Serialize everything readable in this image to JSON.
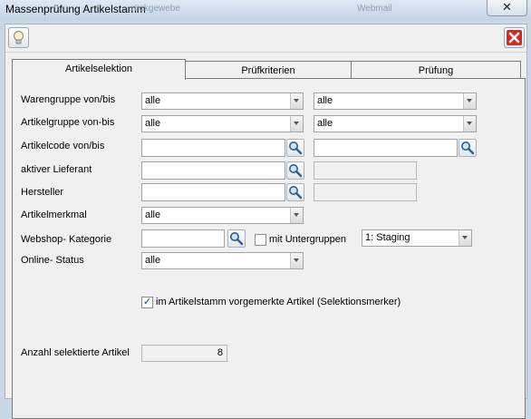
{
  "window": {
    "title": "Massenprüfung Artikelstamm",
    "background_ghost_1": "…rückgewebe",
    "background_ghost_2": "Webmail",
    "close_glyph": "✕"
  },
  "toolbar": {
    "help_icon": "lightbulb-icon",
    "close_icon": "red-x-icon"
  },
  "tabs": [
    {
      "label": "Artikelselektion",
      "active": true
    },
    {
      "label": "Prüfkriterien",
      "active": false
    },
    {
      "label": "Prüfung",
      "active": false
    }
  ],
  "form": {
    "warengruppe": {
      "label": "Warengruppe von/bis",
      "from": "alle",
      "to": "alle"
    },
    "artikelgruppe": {
      "label": "Artikelgruppe von-bis",
      "from": "alle",
      "to": "alle"
    },
    "artikelcode": {
      "label": "Artikelcode von/bis",
      "from": "",
      "to": ""
    },
    "lieferant": {
      "label": "aktiver Lieferant",
      "value": "",
      "display": ""
    },
    "hersteller": {
      "label": "Hersteller",
      "value": "",
      "display": ""
    },
    "artikelmerkmal": {
      "label": "Artikelmerkmal",
      "value": "alle"
    },
    "webshop": {
      "label": "Webshop- Kategorie",
      "value": "",
      "untergruppen_label": "mit Untergruppen",
      "untergruppen_checked": false,
      "staging": "1: Staging"
    },
    "online_status": {
      "label": "Online- Status",
      "value": "alle"
    },
    "selektionsmerker": {
      "label": "im Artikelstamm vorgemerkte Artikel (Selektionsmerker)",
      "checked": true
    },
    "anzahl": {
      "label": "Anzahl selektierte Artikel",
      "value": "8"
    }
  },
  "colors": {
    "accent_close": "#d8281d",
    "titlebar": "#c9d6e4"
  }
}
